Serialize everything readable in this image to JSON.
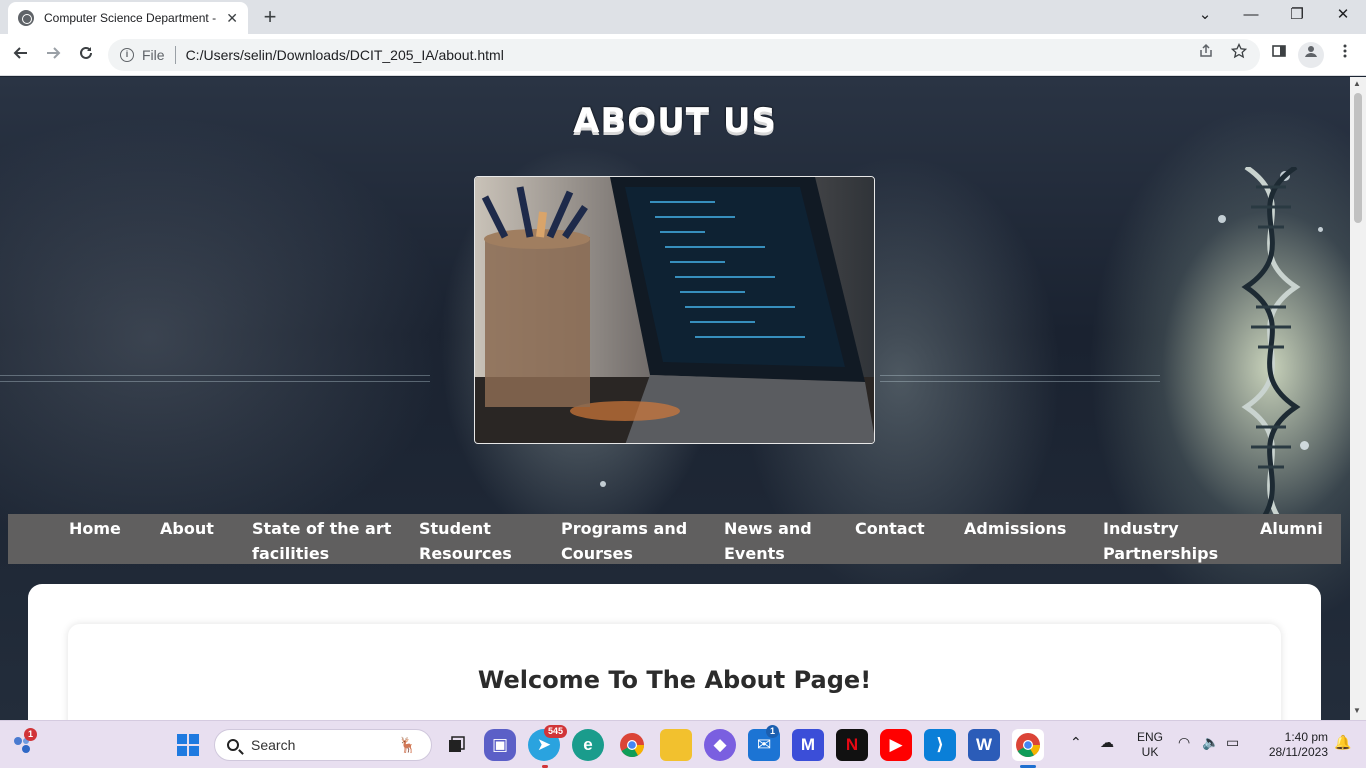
{
  "browser": {
    "tab_title": "Computer Science Department -",
    "close_glyph": "✕",
    "new_tab_glyph": "+",
    "address_scheme": "File",
    "address_url": "C:/Users/selin/Downloads/DCIT_205_IA/about.html",
    "window_controls": [
      "⌄",
      "—",
      "❐",
      "✕"
    ]
  },
  "page": {
    "heading": "ABOUT US",
    "hero_image": "laptop-and-pencil-cup-photo",
    "nav": [
      {
        "label": "Home"
      },
      {
        "label": "About"
      },
      {
        "label": "State of the art facilities"
      },
      {
        "label": "Student Resources"
      },
      {
        "label": "Programs and Courses"
      },
      {
        "label": "News and Events"
      },
      {
        "label": "Contact"
      },
      {
        "label": "Admissions"
      },
      {
        "label": "Industry Partnerships"
      },
      {
        "label": "Alumni"
      }
    ],
    "welcome_heading": "Welcome To The About Page!"
  },
  "taskbar": {
    "search_label": "Search",
    "widgets_badge": "1",
    "telegram_badge": "545",
    "mail_badge": "1",
    "language_top": "ENG",
    "language_bottom": "UK",
    "time": "1:40 pm",
    "date": "28/11/2023"
  },
  "colors": {
    "nav_background": "#605f5f",
    "tab_strip": "#dee1e6",
    "taskbar": "#e8dff0"
  }
}
